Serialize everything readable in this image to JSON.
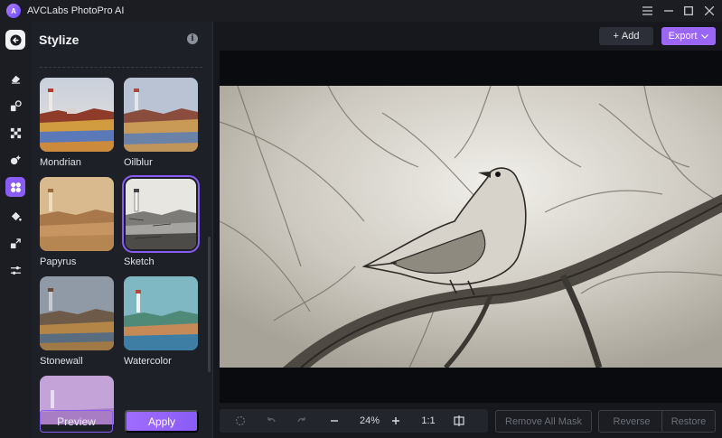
{
  "window": {
    "title": "AVCLabs PhotoPro AI",
    "logo_text": "A"
  },
  "titlebar": {
    "menu_icon": "hamburger-icon",
    "minimize_icon": "minimize-icon",
    "maximize_icon": "maximize-icon",
    "close_icon": "close-icon"
  },
  "rail": {
    "items": [
      "back-arrow-icon",
      "eraser-icon",
      "enhance-icon",
      "upscale-icon",
      "colorize-icon",
      "stylize-icon",
      "paint-bucket-icon",
      "resize-icon",
      "adjust-icon"
    ],
    "active": "stylize-icon"
  },
  "panel": {
    "title": "Stylize",
    "styles": [
      {
        "label": "Mondrian"
      },
      {
        "label": "Oilblur"
      },
      {
        "label": "Papyrus"
      },
      {
        "label": "Sketch",
        "selected": true
      },
      {
        "label": "Stonewall"
      },
      {
        "label": "Watercolor"
      }
    ],
    "preview_label": "Preview",
    "apply_label": "Apply"
  },
  "toolbar": {
    "add_label": "Add",
    "add_prefix": "+",
    "export_label": "Export"
  },
  "bottom": {
    "zoom": "24%",
    "ratio": "1:1",
    "remove_all_mask": "Remove All Mask",
    "reverse": "Reverse",
    "restore": "Restore"
  },
  "colors": {
    "accent": "#8a5cf6",
    "background": "#16181e",
    "panel": "#1e2027"
  }
}
